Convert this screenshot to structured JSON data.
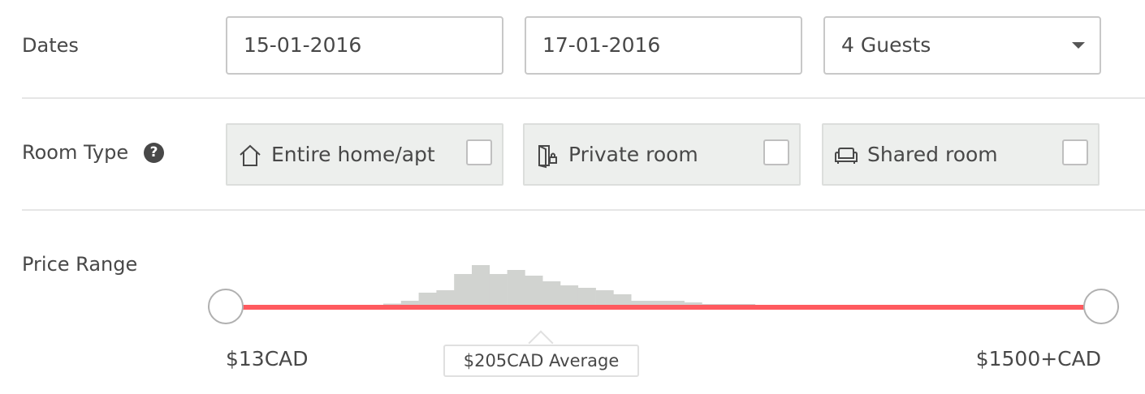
{
  "dates": {
    "label": "Dates",
    "checkin_value": "15-01-2016",
    "checkout_value": "17-01-2016",
    "guests_selected": "4 Guests"
  },
  "room_type": {
    "label": "Room Type",
    "help_icon": "question-circle-icon",
    "options": [
      {
        "label": "Entire home/apt",
        "icon": "house-icon",
        "checked": false
      },
      {
        "label": "Private room",
        "icon": "door-lock-icon",
        "checked": false
      },
      {
        "label": "Shared room",
        "icon": "sofa-icon",
        "checked": false
      }
    ]
  },
  "price_range": {
    "label": "Price Range",
    "min_label": "$13CAD",
    "max_label": "$1500+CAD",
    "average_label": "$205CAD Average",
    "slider_min_fraction": 0,
    "slider_max_fraction": 1,
    "track_color": "#ff5a5f",
    "histogram_color": "#d1d3d0",
    "histogram_heights": [
      0.05,
      0.12,
      0.32,
      0.38,
      0.78,
      1.0,
      0.78,
      0.88,
      0.74,
      0.6,
      0.5,
      0.44,
      0.38,
      0.28,
      0.12,
      0.12,
      0.12,
      0.08,
      0.04,
      0.04,
      0.04,
      0.02
    ]
  }
}
